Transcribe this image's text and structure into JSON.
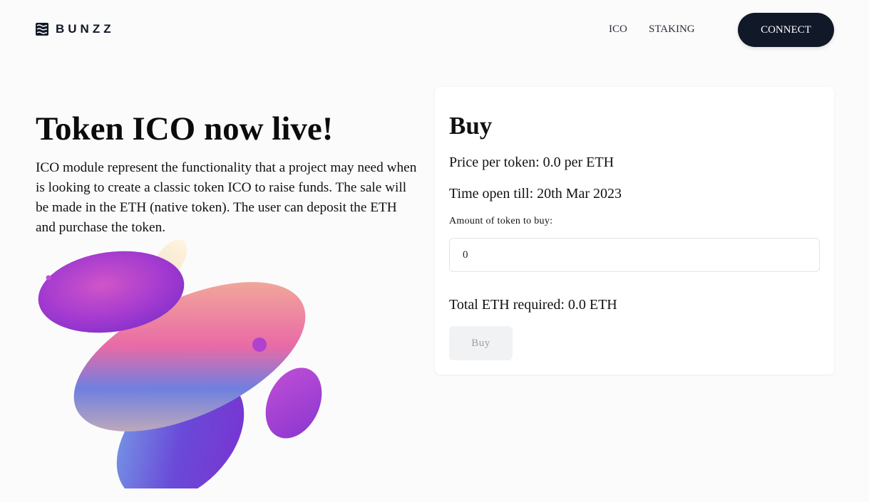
{
  "brand": {
    "name": "BUNZZ",
    "logo_icon": "stacked-waves-icon"
  },
  "nav": {
    "items": [
      {
        "label": "ICO"
      },
      {
        "label": "STAKING"
      }
    ],
    "connect_label": "CONNECT"
  },
  "hero": {
    "title": "Token ICO now live!",
    "description": "ICO module represent the functionality that a project may need when is looking to create a classic token ICO to raise funds. The sale will be made in the ETH (native token). The user can deposit the ETH and purchase the token."
  },
  "buy_card": {
    "title": "Buy",
    "price_line": "Price per token: 0.0 per ETH",
    "time_line": "Time open till: 20th Mar 2023",
    "amount_label": "Amount of token to buy:",
    "amount_value": "0",
    "total_line": "Total ETH required: 0.0 ETH",
    "buy_label": "Buy"
  },
  "colors": {
    "page_bg": "#fbfbfb",
    "dark": "#111827",
    "card_bg": "#ffffff",
    "disabled_button_bg": "#f1f2f4",
    "disabled_button_text": "#9aa0aa",
    "blob_purple": "#a33ad0",
    "blob_peach": "#f3b98e",
    "blob_blue": "#6a86e0"
  }
}
